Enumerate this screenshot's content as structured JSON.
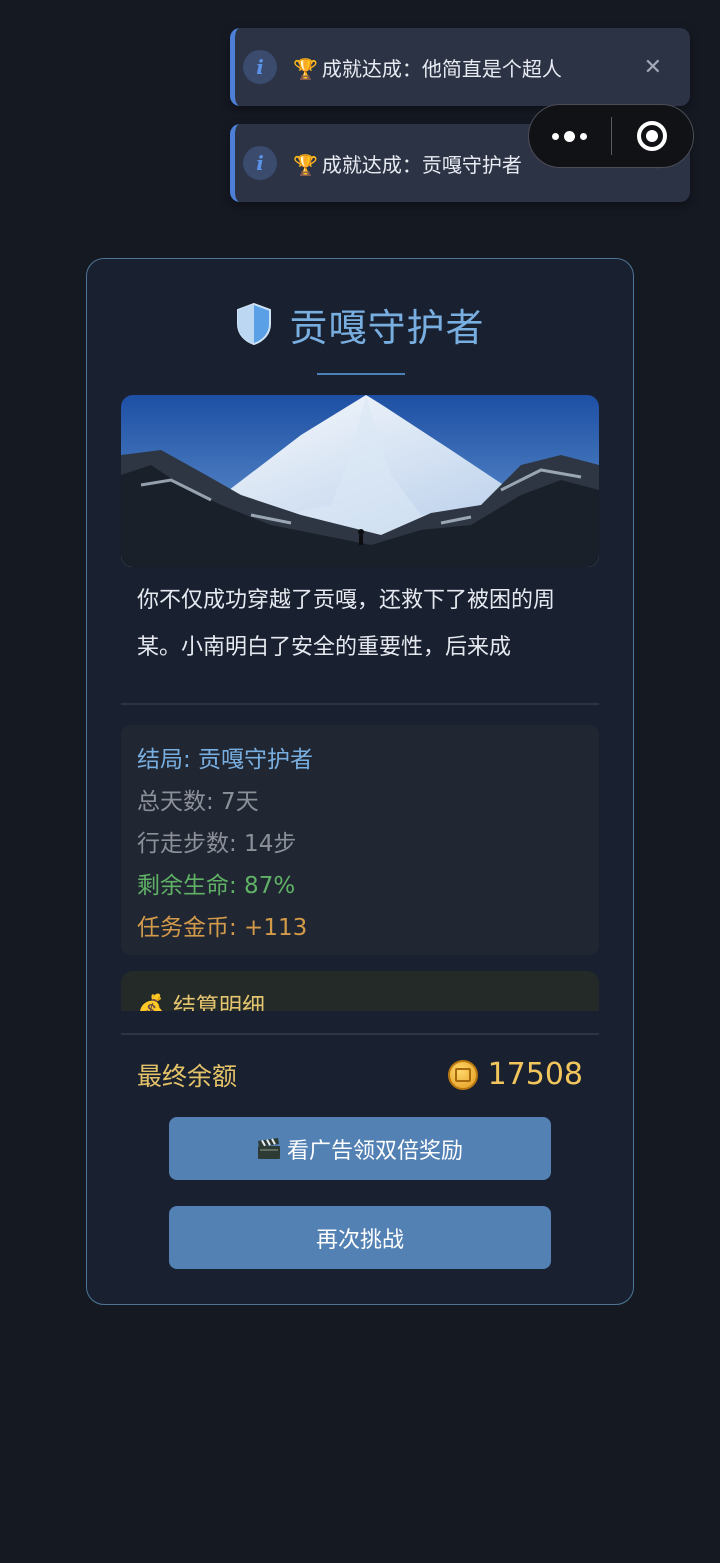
{
  "toasts": [
    {
      "icon": "info-icon",
      "trophy": "🏆",
      "text": "成就达成：他简直是个超人",
      "close": "✕"
    },
    {
      "icon": "info-icon",
      "trophy": "🏆",
      "text": "成就达成：贡嘎守护者",
      "close": "✕"
    }
  ],
  "capsule": {
    "menu_icon": "more-dots-icon",
    "close_icon": "target-circle-icon"
  },
  "card": {
    "title": "贡嘎守护者",
    "story": "你不仅成功穿越了贡嘎，还救下了被困的周某。小南明白了安全的重要性，后来成",
    "stats": {
      "ending": "结局: 贡嘎守护者",
      "days": "总天数: 7天",
      "steps": "行走步数: 14步",
      "life": "剩余生命: 87%",
      "coins": "任务金币: +113"
    },
    "detail_icon": "💰",
    "detail_title": "结算明细",
    "final_label": "最终余额",
    "final_amount": "17508",
    "ad_button_icon": "🎬",
    "ad_button": "看广告领双倍奖励",
    "retry_button": "再次挑战"
  },
  "colors": {
    "accent": "#79aee0",
    "button": "#5381b4",
    "gold": "#f3c65d",
    "life": "#5fb166"
  }
}
